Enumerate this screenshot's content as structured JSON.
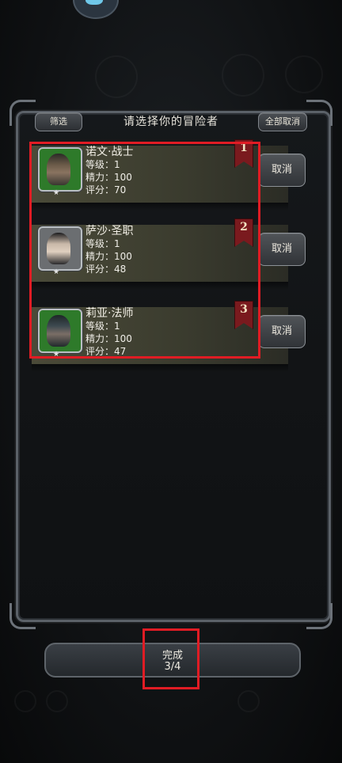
{
  "header": {
    "title": "请选择你的冒险者",
    "filter_label": "筛选",
    "cancel_all_label": "全部取消"
  },
  "adventurers": [
    {
      "slot": "1",
      "name": "诺文·战士",
      "level": "等级：1",
      "energy": "精力：100",
      "score": "评分：70",
      "cancel_label": "取消",
      "avatar_icon": "warrior-portrait-icon",
      "frame_color": "#2e7a2a"
    },
    {
      "slot": "2",
      "name": "萨沙·圣职",
      "level": "等级：1",
      "energy": "精力：100",
      "score": "评分：48",
      "cancel_label": "取消",
      "avatar_icon": "cleric-portrait-icon",
      "frame_color": "#6b6e71"
    },
    {
      "slot": "3",
      "name": "莉亚·法师",
      "level": "等级：1",
      "energy": "精力：100",
      "score": "评分：47",
      "cancel_label": "取消",
      "avatar_icon": "mage-portrait-icon",
      "frame_color": "#2e7a2a"
    }
  ],
  "footer": {
    "done_label": "完成",
    "done_count": "3/4"
  },
  "colors": {
    "highlight": "#e01c24",
    "ribbon": "#7a1a1e"
  }
}
